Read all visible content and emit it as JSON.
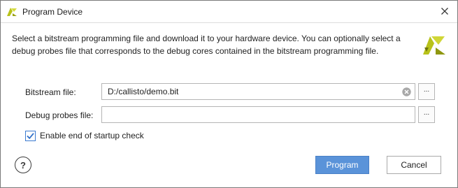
{
  "window": {
    "title": "Program Device",
    "logo_icon": "xilinx-logo-icon",
    "close_icon": "close-icon"
  },
  "description": "Select a bitstream programming file and download it to your hardware device. You can optionally select a debug probes file that corresponds to the debug cores contained in the bitstream programming file.",
  "form": {
    "bitstream": {
      "label": "Bitstream file:",
      "value": "D:/callisto/demo.bit",
      "browse_label": "..."
    },
    "probes": {
      "label": "Debug probes file:",
      "value": "",
      "browse_label": "..."
    },
    "startup_check": {
      "label": "Enable end of startup check",
      "checked": true
    }
  },
  "buttons": {
    "help_label": "?",
    "program_label": "Program",
    "cancel_label": "Cancel"
  },
  "colors": {
    "accent": "#5a93d9",
    "logo": "#b8c21a"
  }
}
